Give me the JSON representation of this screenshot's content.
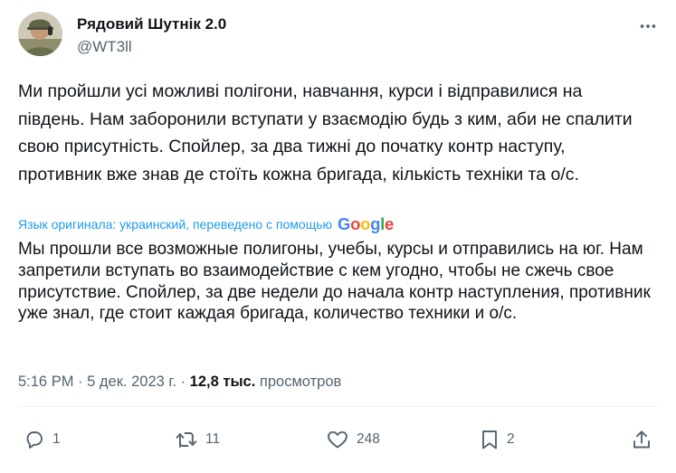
{
  "tweet": {
    "author": {
      "display_name": "Рядовий Шутнік 2.0",
      "handle": "@WT3ll"
    },
    "text": "Ми пройшли усі можливі полігони, навчання, курси і відправилися на південь. Нам заборонили вступати у взаємодію будь з ким, аби не спалити свою присутність. Спойлер, за два тижні до початку контр наступу, противник вже знав де стоїть кожна бригада, кількість техніки та о/с.",
    "translation_note": "Язык оригинала: украинский, переведено с помощью",
    "translation_provider": "Google",
    "translated_text": "Мы прошли все возможные полигоны, учебы, курсы и отправились на юг. Нам запретили вступать во взаимодействие с кем угодно, чтобы не сжечь свое присутствие. Спойлер, за две недели до начала контр наступления, противник уже знал, где стоит каждая бригада, количество техники и о/с.",
    "time": "5:16 PM",
    "separator": "·",
    "date": "5 дек. 2023 г.",
    "views_count": "12,8 тыс.",
    "views_label": "просмотров"
  },
  "actions": {
    "replies": "1",
    "reposts": "11",
    "likes": "248",
    "bookmarks": "2"
  },
  "colors": {
    "text": "#0f1419",
    "secondary": "#536471",
    "link": "#1d9bf0",
    "divider": "#eff3f4"
  },
  "icons": {
    "more": "more-dots-icon",
    "reply": "reply-bubble-icon",
    "repost": "repost-arrows-icon",
    "like": "heart-icon",
    "bookmark": "bookmark-icon",
    "share": "share-upload-icon"
  }
}
